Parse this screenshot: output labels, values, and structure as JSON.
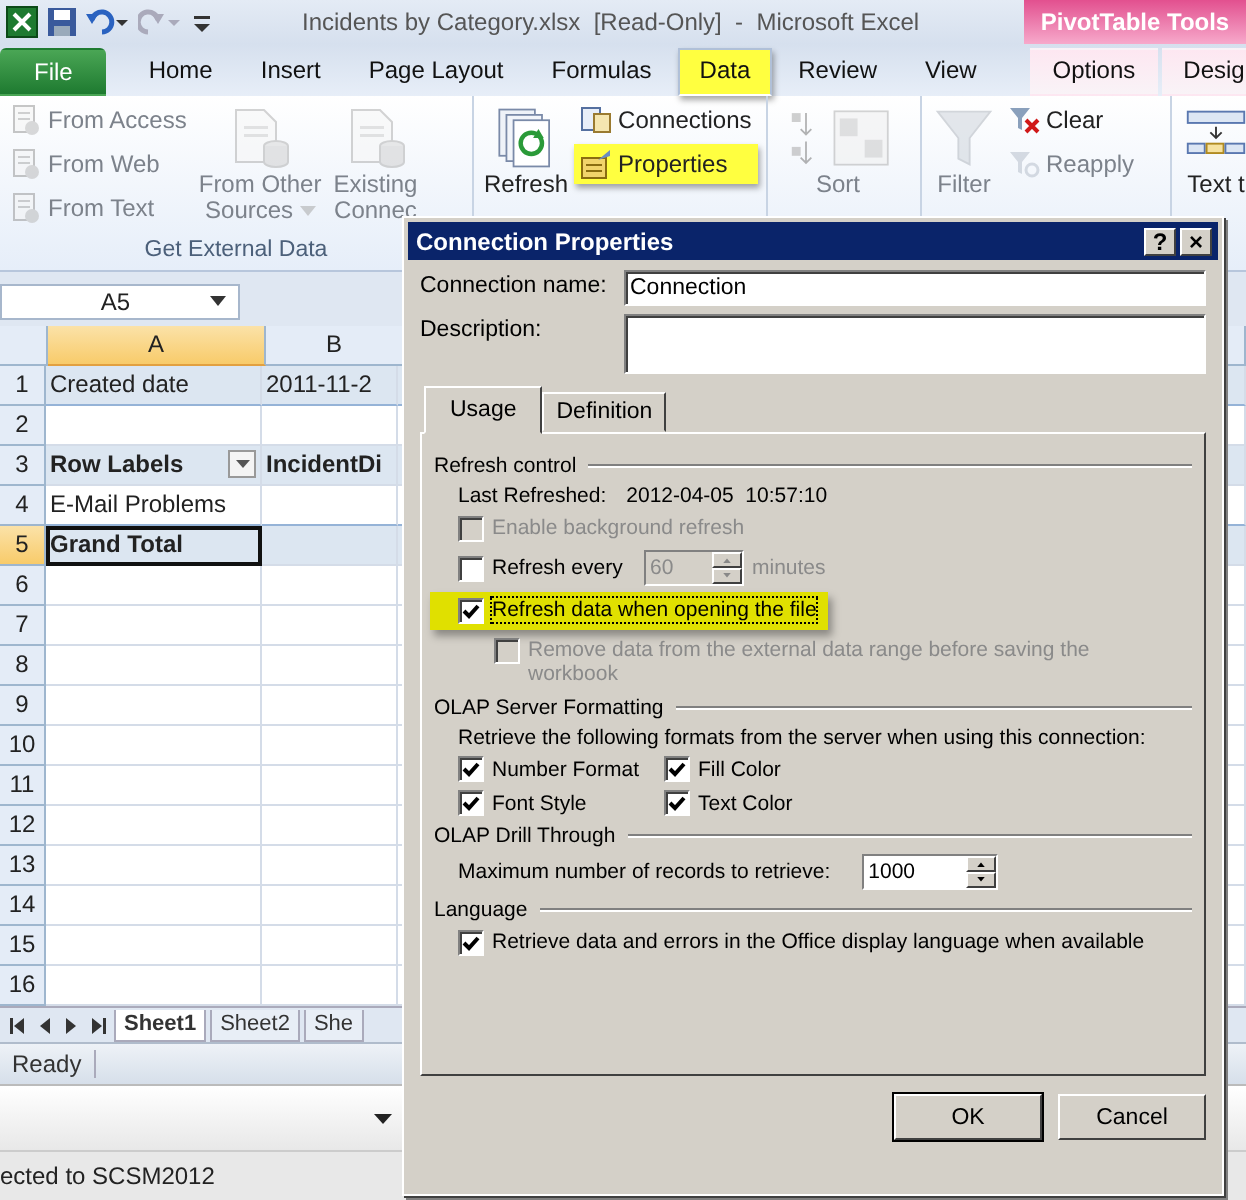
{
  "title_bar": {
    "title": "Incidents by Category.xlsx  [Read-Only]  -  Microsoft Excel",
    "context_tab": "PivotTable Tools"
  },
  "tabs": [
    {
      "label": "File",
      "kind": "file",
      "selected": false,
      "highlighted": false
    },
    {
      "label": "Home",
      "kind": "tab",
      "selected": false,
      "highlighted": false
    },
    {
      "label": "Insert",
      "kind": "tab",
      "selected": false,
      "highlighted": false
    },
    {
      "label": "Page Layout",
      "kind": "tab",
      "selected": false,
      "highlighted": false
    },
    {
      "label": "Formulas",
      "kind": "tab",
      "selected": false,
      "highlighted": false
    },
    {
      "label": "Data",
      "kind": "tab",
      "selected": true,
      "highlighted": true
    },
    {
      "label": "Review",
      "kind": "tab",
      "selected": false,
      "highlighted": false
    },
    {
      "label": "View",
      "kind": "tab",
      "selected": false,
      "highlighted": false
    },
    {
      "label": "Options",
      "kind": "context",
      "selected": false,
      "highlighted": false
    },
    {
      "label": "Desig",
      "kind": "context",
      "selected": false,
      "highlighted": false
    }
  ],
  "ribbon": [
    {
      "label": "Get External Data",
      "items": [
        {
          "kind": "stack",
          "buttons": [
            {
              "label": "From Access",
              "disabled": true,
              "highlighted": false
            },
            {
              "label": "From Web",
              "disabled": true,
              "highlighted": false
            },
            {
              "label": "From Text",
              "disabled": true,
              "highlighted": false
            }
          ]
        },
        {
          "kind": "large",
          "lines": [
            "From Other",
            "Sources"
          ],
          "disabled": true,
          "caret": true
        },
        {
          "kind": "large",
          "lines": [
            "Existing",
            "Connec"
          ],
          "disabled": true,
          "caret": false
        }
      ]
    },
    {
      "items": [
        {
          "kind": "large",
          "lines": [
            "Refresh"
          ],
          "disabled": false,
          "caret": false
        },
        {
          "kind": "stack",
          "buttons": [
            {
              "label": "Connections",
              "disabled": false,
              "highlighted": false
            },
            {
              "label": "Properties",
              "disabled": false,
              "highlighted": true
            }
          ]
        }
      ]
    },
    {
      "items": [
        {
          "kind": "large",
          "lines": [
            "Sort"
          ],
          "disabled": true,
          "caret": false
        }
      ]
    },
    {
      "items": [
        {
          "kind": "large",
          "lines": [
            "Filter"
          ],
          "disabled": true,
          "caret": false
        },
        {
          "kind": "stack",
          "buttons": [
            {
              "label": "Clear",
              "disabled": false,
              "highlighted": false
            },
            {
              "label": "Reapply",
              "disabled": true,
              "highlighted": false
            }
          ]
        }
      ]
    },
    {
      "items": [
        {
          "kind": "large",
          "lines": [
            "Text t"
          ],
          "disabled": false,
          "caret": false
        }
      ]
    }
  ],
  "formula_bar": {
    "name_box": "A5"
  },
  "sheet": {
    "columns": [
      {
        "label": "A",
        "selected": true
      },
      {
        "label": "B",
        "selected": false
      }
    ],
    "rows": [
      {
        "number": "1",
        "kind": "filter",
        "selected": false,
        "cells": [
          {
            "text": "Created date",
            "selected": false,
            "filter_button": false
          },
          {
            "text": "2011-11-2",
            "selected": false,
            "filter_button": false
          }
        ]
      },
      {
        "number": "2",
        "kind": "empty",
        "selected": false
      },
      {
        "number": "3",
        "kind": "header",
        "selected": false,
        "cells": [
          {
            "text": "Row Labels",
            "selected": false,
            "filter_button": true
          },
          {
            "text": "IncidentDi",
            "selected": false,
            "filter_button": false
          }
        ]
      },
      {
        "number": "4",
        "kind": "item",
        "selected": false,
        "cells": [
          {
            "text": "E-Mail Problems",
            "selected": false,
            "filter_button": false
          }
        ]
      },
      {
        "number": "5",
        "kind": "total",
        "selected": true,
        "cells": [
          {
            "text": "Grand Total",
            "selected": true,
            "filter_button": false
          }
        ]
      },
      {
        "number": "6",
        "kind": "empty",
        "selected": false
      },
      {
        "number": "7",
        "kind": "empty",
        "selected": false
      },
      {
        "number": "8",
        "kind": "empty",
        "selected": false
      },
      {
        "number": "9",
        "kind": "empty",
        "selected": false
      },
      {
        "number": "10",
        "kind": "empty",
        "selected": false
      },
      {
        "number": "11",
        "kind": "empty",
        "selected": false
      },
      {
        "number": "12",
        "kind": "empty",
        "selected": false
      },
      {
        "number": "13",
        "kind": "empty",
        "selected": false
      },
      {
        "number": "14",
        "kind": "empty",
        "selected": false
      },
      {
        "number": "15",
        "kind": "empty",
        "selected": false
      },
      {
        "number": "16",
        "kind": "empty",
        "selected": false
      }
    ]
  },
  "sheet_tabs": [
    {
      "label": "Sheet1",
      "selected": true
    },
    {
      "label": "Sheet2",
      "selected": false
    },
    {
      "label": "She",
      "selected": false
    }
  ],
  "status_bar": {
    "text": "Ready"
  },
  "connection_bar": {
    "text": "ected to SCSM2012"
  },
  "dialog": {
    "title": "Connection Properties",
    "help": "?",
    "close": "×",
    "name_label": "Connection name:",
    "name_value": "Connection",
    "description_label": "Description:",
    "tabs": [
      {
        "label": "Usage",
        "selected": true
      },
      {
        "label": "Definition",
        "selected": false
      }
    ],
    "sections": [
      {
        "title": "Refresh control",
        "items": [
          {
            "kind": "info",
            "label": "Last Refreshed:",
            "value": "2012-04-05  10:57:10"
          },
          {
            "kind": "checkbox",
            "label": "Enable background refresh",
            "checked": false,
            "disabled": true,
            "highlighted": false,
            "indented": false
          },
          {
            "kind": "interval",
            "label": "Refresh every",
            "checked": false,
            "value": "60",
            "unit": "minutes"
          },
          {
            "kind": "checkbox",
            "label": "Refresh data when opening the file",
            "checked": true,
            "disabled": false,
            "highlighted": true,
            "indented": false
          },
          {
            "kind": "checkbox",
            "label": "Remove data from the external data range before saving the workbook",
            "checked": false,
            "disabled": true,
            "highlighted": false,
            "indented": true
          }
        ]
      },
      {
        "title": "OLAP Server Formatting",
        "items": [
          {
            "kind": "text",
            "label": "Retrieve the following formats from the server when using this connection:"
          },
          {
            "kind": "grid",
            "options": [
              {
                "label": "Number Format",
                "checked": true
              },
              {
                "label": "Fill Color",
                "checked": true
              },
              {
                "label": "Font Style",
                "checked": true
              },
              {
                "label": "Text Color",
                "checked": true
              }
            ]
          }
        ]
      },
      {
        "title": "OLAP Drill Through",
        "items": [
          {
            "kind": "spin",
            "label": "Maximum number of records to retrieve:",
            "value": "1000"
          }
        ]
      },
      {
        "title": "Language",
        "items": [
          {
            "kind": "checkbox",
            "label": "Retrieve data and errors in the Office display language when available",
            "checked": true,
            "disabled": false,
            "highlighted": false,
            "indented": false
          }
        ]
      }
    ],
    "buttons": [
      "OK",
      "Cancel"
    ]
  }
}
